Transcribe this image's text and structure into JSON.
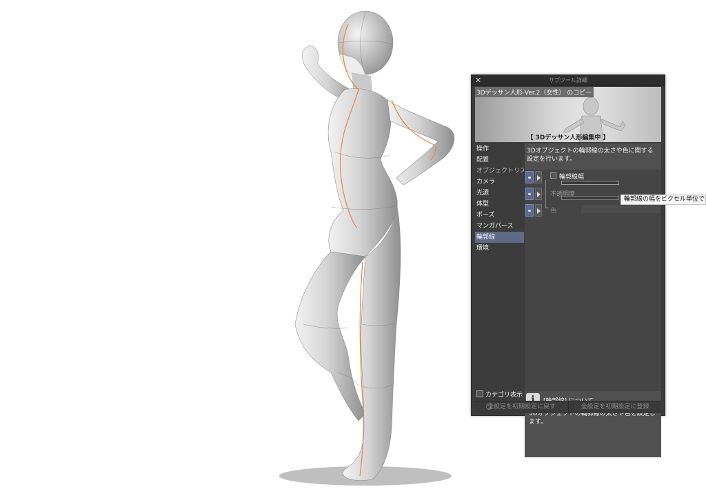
{
  "panel": {
    "close_icon": "close-icon",
    "title": "サブツール詳細",
    "preview_title": "3Dデッサン人形-Ver.2（女性） のコピー",
    "preview_status": "【 3Dデッサン人形編集中 】",
    "menu": [
      {
        "label": "操作"
      },
      {
        "label": "配置"
      },
      {
        "label": "オブジェクトリスト"
      },
      {
        "label": "カメラ"
      },
      {
        "label": "光源"
      },
      {
        "label": "体型"
      },
      {
        "label": "ポーズ"
      },
      {
        "label": "マンガパース"
      },
      {
        "label": "輪郭線",
        "active": true
      },
      {
        "label": "環境"
      }
    ],
    "description": "3Dオブジェクトの輪郭線の太さや色に関する設定を行います。",
    "settings": {
      "outline_width_label": "輪郭線幅",
      "opacity_label": "不透明度",
      "color_label": "色"
    },
    "tooltip": "輪郭線の幅をピクセル単位で指定",
    "help": {
      "icon": "info-icon",
      "icon_glyph": "i",
      "title": "[輪郭線] について",
      "body": "3Dオブジェクトの輪郭線の太さや色を設定します。"
    },
    "category_display_label": "カテゴリ表示",
    "footer": {
      "reset_label": "全設定を初期設定に戻す",
      "register_label": "全設定を初期設定に登録"
    },
    "colors": {
      "panel_bg": "#3c3c3c",
      "active_item": "#5e6a86",
      "outline_accent": "#e8863a"
    }
  },
  "figure": {
    "description_icon": "3d-drawing-doll"
  }
}
